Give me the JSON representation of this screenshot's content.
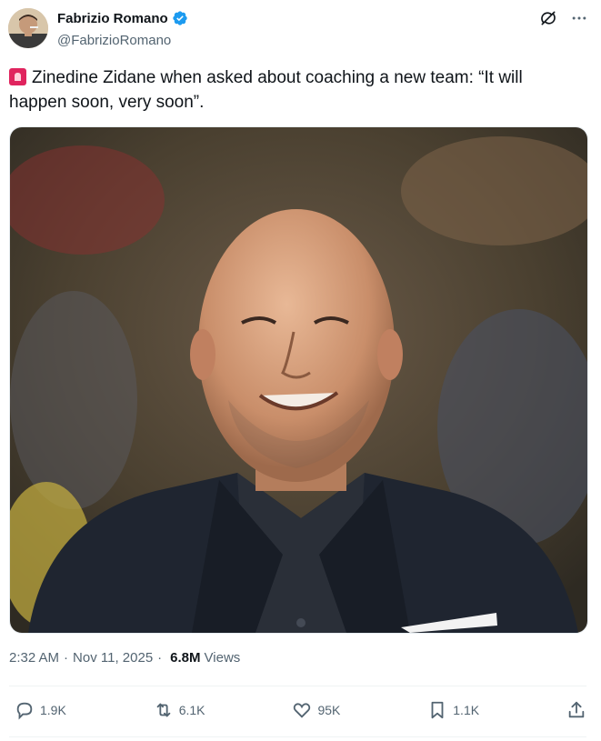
{
  "author": {
    "display_name": "Fabrizio Romano",
    "handle": "@FabrizioRomano",
    "verified": true
  },
  "tweet": {
    "text": "Zinedine Zidane when asked about coaching a new team: “It will happen soon, very soon”.",
    "leading_emoji": "rotating-light"
  },
  "meta": {
    "time": "2:32 AM",
    "separator": "·",
    "date": "Nov 11, 2025",
    "views_count": "6.8M",
    "views_label": "Views"
  },
  "actions": {
    "reply_count": "1.9K",
    "repost_count": "6.1K",
    "like_count": "95K",
    "bookmark_count": "1.1K"
  },
  "icons": [
    "verified-badge-icon",
    "grok-icon",
    "more-icon",
    "reply-icon",
    "repost-icon",
    "like-icon",
    "bookmark-icon",
    "share-icon"
  ],
  "colors": {
    "verified": "#1d9bf0",
    "text": "#0f1419",
    "secondary": "#536471"
  }
}
